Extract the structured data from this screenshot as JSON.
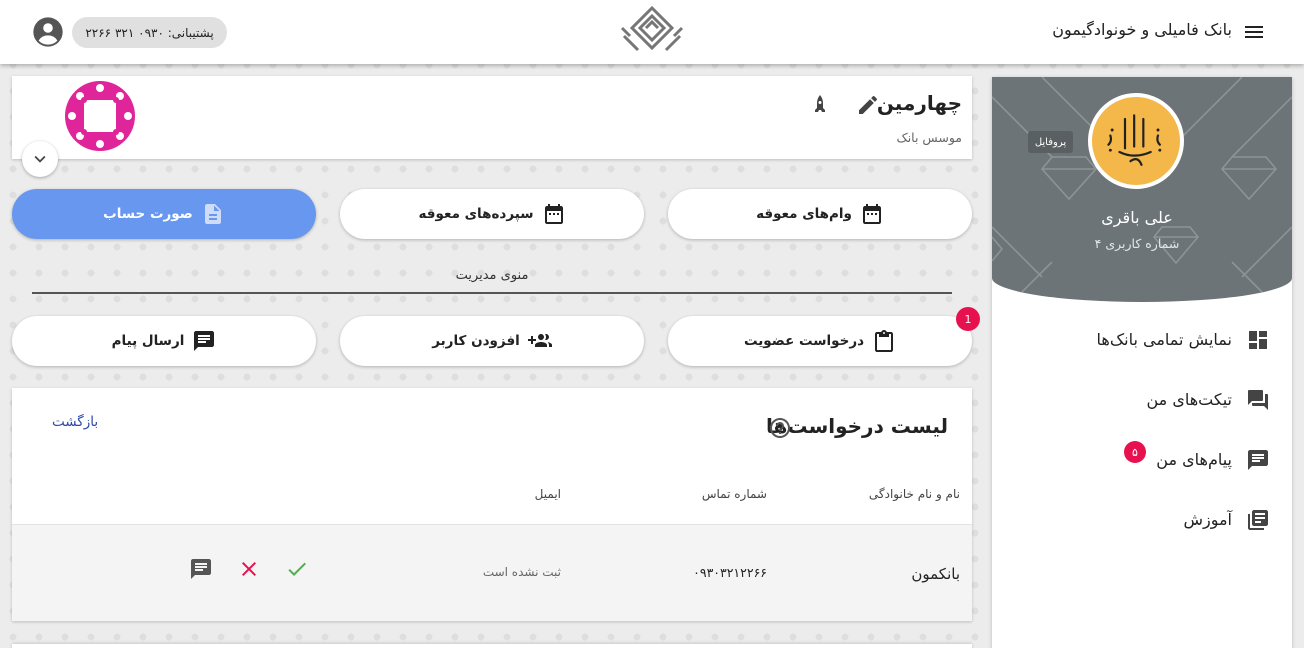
{
  "app": {
    "title": "بانک فامیلی و خونوادگیمون",
    "support_label": "پشتیبانی: ۰۹۳۰ ۳۲۱ ۲۲۶۶"
  },
  "profile": {
    "tooltip": "پروفایل",
    "name": "علی باقری",
    "user_id": "شماره کاربری ۴"
  },
  "sidebar": {
    "items": [
      {
        "label": "نمایش تمامی بانک‌ها",
        "icon": "dashboard-icon"
      },
      {
        "label": "تیکت‌های من",
        "icon": "forum-icon"
      },
      {
        "label": "پیام‌های من",
        "icon": "message-icon",
        "badge": "۵"
      },
      {
        "label": "آموزش",
        "icon": "library-books-icon"
      }
    ]
  },
  "bank": {
    "name": "چهارمین",
    "subtitle": "موسس بانک"
  },
  "actions": {
    "overdue_loans": "وام‌های معوقه",
    "overdue_deposits": "سپرده‌های معوقه",
    "statement": "صورت حساب"
  },
  "admin": {
    "title": "منوی مدیریت",
    "membership_request": "درخواست عضویت",
    "membership_badge": "1",
    "add_user": "افزودن کاربر",
    "send_message": "ارسال پیام"
  },
  "requests": {
    "title": "لیست درخواست‌ها",
    "back": "بازگشت",
    "columns": {
      "name": "نام و نام خانوادگی",
      "phone": "شماره تماس",
      "email": "ایمیل"
    },
    "rows": [
      {
        "name": "بانکمون",
        "phone": "۰۹۳۰۳۲۱۲۲۶۶",
        "email": "ثبت نشده است"
      }
    ]
  },
  "colors": {
    "accent_blue": "#6897ef",
    "badge_red": "#e8114f",
    "approve_green": "#4caf50",
    "reject_red": "#e8114f",
    "link_blue": "#2c48a8"
  }
}
